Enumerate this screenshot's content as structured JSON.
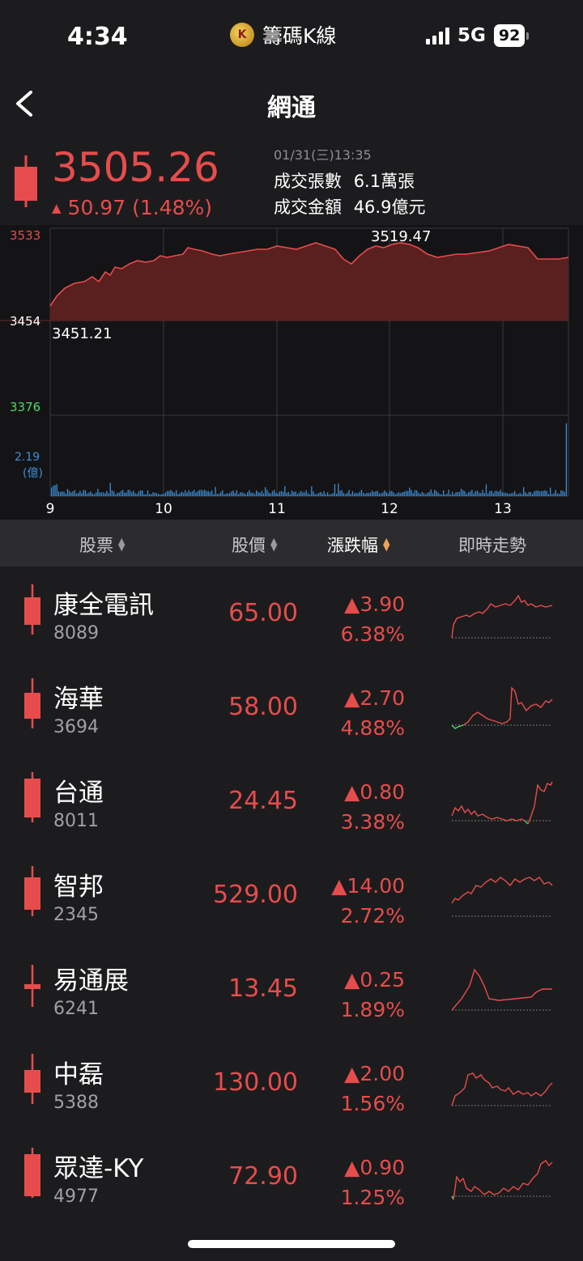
{
  "status_bar": {
    "time": "4:34",
    "app_name": "籌碼K線",
    "network": "5G",
    "battery": "92"
  },
  "nav": {
    "title": "網通"
  },
  "quote": {
    "price": "3505.26",
    "change": "50.97",
    "change_pct": "(1.48%)",
    "datetime": "01/31(三)13:35",
    "volume_label": "成交張數",
    "volume_value": "6.1萬張",
    "amount_label": "成交金額",
    "amount_value": "46.9億元"
  },
  "chart": {
    "y_high": "3533",
    "y_mid": "3454",
    "y_low": "3376",
    "vol_max": "2.19",
    "vol_unit": "(億)",
    "high_label": "3519.47",
    "low_label": "3451.21",
    "x_ticks": [
      "9",
      "10",
      "11",
      "12",
      "13"
    ],
    "colors": {
      "up": "#e74c4c",
      "down": "#4cd964",
      "volume": "#3b8fd9"
    }
  },
  "table": {
    "headers": {
      "stock": "股票",
      "price": "股價",
      "change": "漲跌幅",
      "trend": "即時走勢"
    },
    "rows": [
      {
        "name": "康全電訊",
        "code": "8089",
        "price": "65.00",
        "change": "▲3.90",
        "pct": "6.38%"
      },
      {
        "name": "海華",
        "code": "3694",
        "price": "58.00",
        "change": "▲2.70",
        "pct": "4.88%"
      },
      {
        "name": "台通",
        "code": "8011",
        "price": "24.45",
        "change": "▲0.80",
        "pct": "3.38%"
      },
      {
        "name": "智邦",
        "code": "2345",
        "price": "529.00",
        "change": "▲14.00",
        "pct": "2.72%"
      },
      {
        "name": "易通展",
        "code": "6241",
        "price": "13.45",
        "change": "▲0.25",
        "pct": "1.89%"
      },
      {
        "name": "中磊",
        "code": "5388",
        "price": "130.00",
        "change": "▲2.00",
        "pct": "1.56%"
      },
      {
        "name": "眾達-KY",
        "code": "4977",
        "price": "72.90",
        "change": "▲0.90",
        "pct": "1.25%"
      }
    ]
  }
}
